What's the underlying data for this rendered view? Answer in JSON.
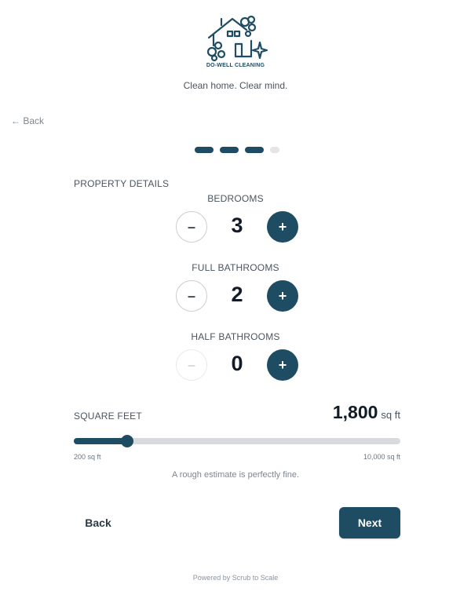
{
  "brand": {
    "name": "DO-WELL CLEANING",
    "tagline": "Clean home. Clear mind.",
    "logo_icon": "house-cleaning-logo-icon",
    "color": "#1e4d63"
  },
  "nav": {
    "back_link": "← Back"
  },
  "progress": {
    "total_steps": 4,
    "current_step": 3
  },
  "section": {
    "title": "PROPERTY DETAILS"
  },
  "counters": {
    "bedrooms": {
      "label": "BEDROOMS",
      "value": "3",
      "minus": "–",
      "plus": "+",
      "minus_disabled": false
    },
    "full_bathrooms": {
      "label": "FULL BATHROOMS",
      "value": "2",
      "minus": "–",
      "plus": "+",
      "minus_disabled": false
    },
    "half_bathrooms": {
      "label": "HALF BATHROOMS",
      "value": "0",
      "minus": "–",
      "plus": "+",
      "minus_disabled": true
    }
  },
  "square_feet": {
    "label": "SQUARE FEET",
    "value_display": "1,800",
    "unit": "sq ft",
    "value": 1800,
    "min": 200,
    "max": 10000,
    "min_label": "200 sq ft",
    "max_label": "10,000 sq ft",
    "hint": "A rough estimate is perfectly fine."
  },
  "actions": {
    "back": "Back",
    "next": "Next"
  },
  "footer": {
    "text": "Powered by Scrub to Scale"
  }
}
